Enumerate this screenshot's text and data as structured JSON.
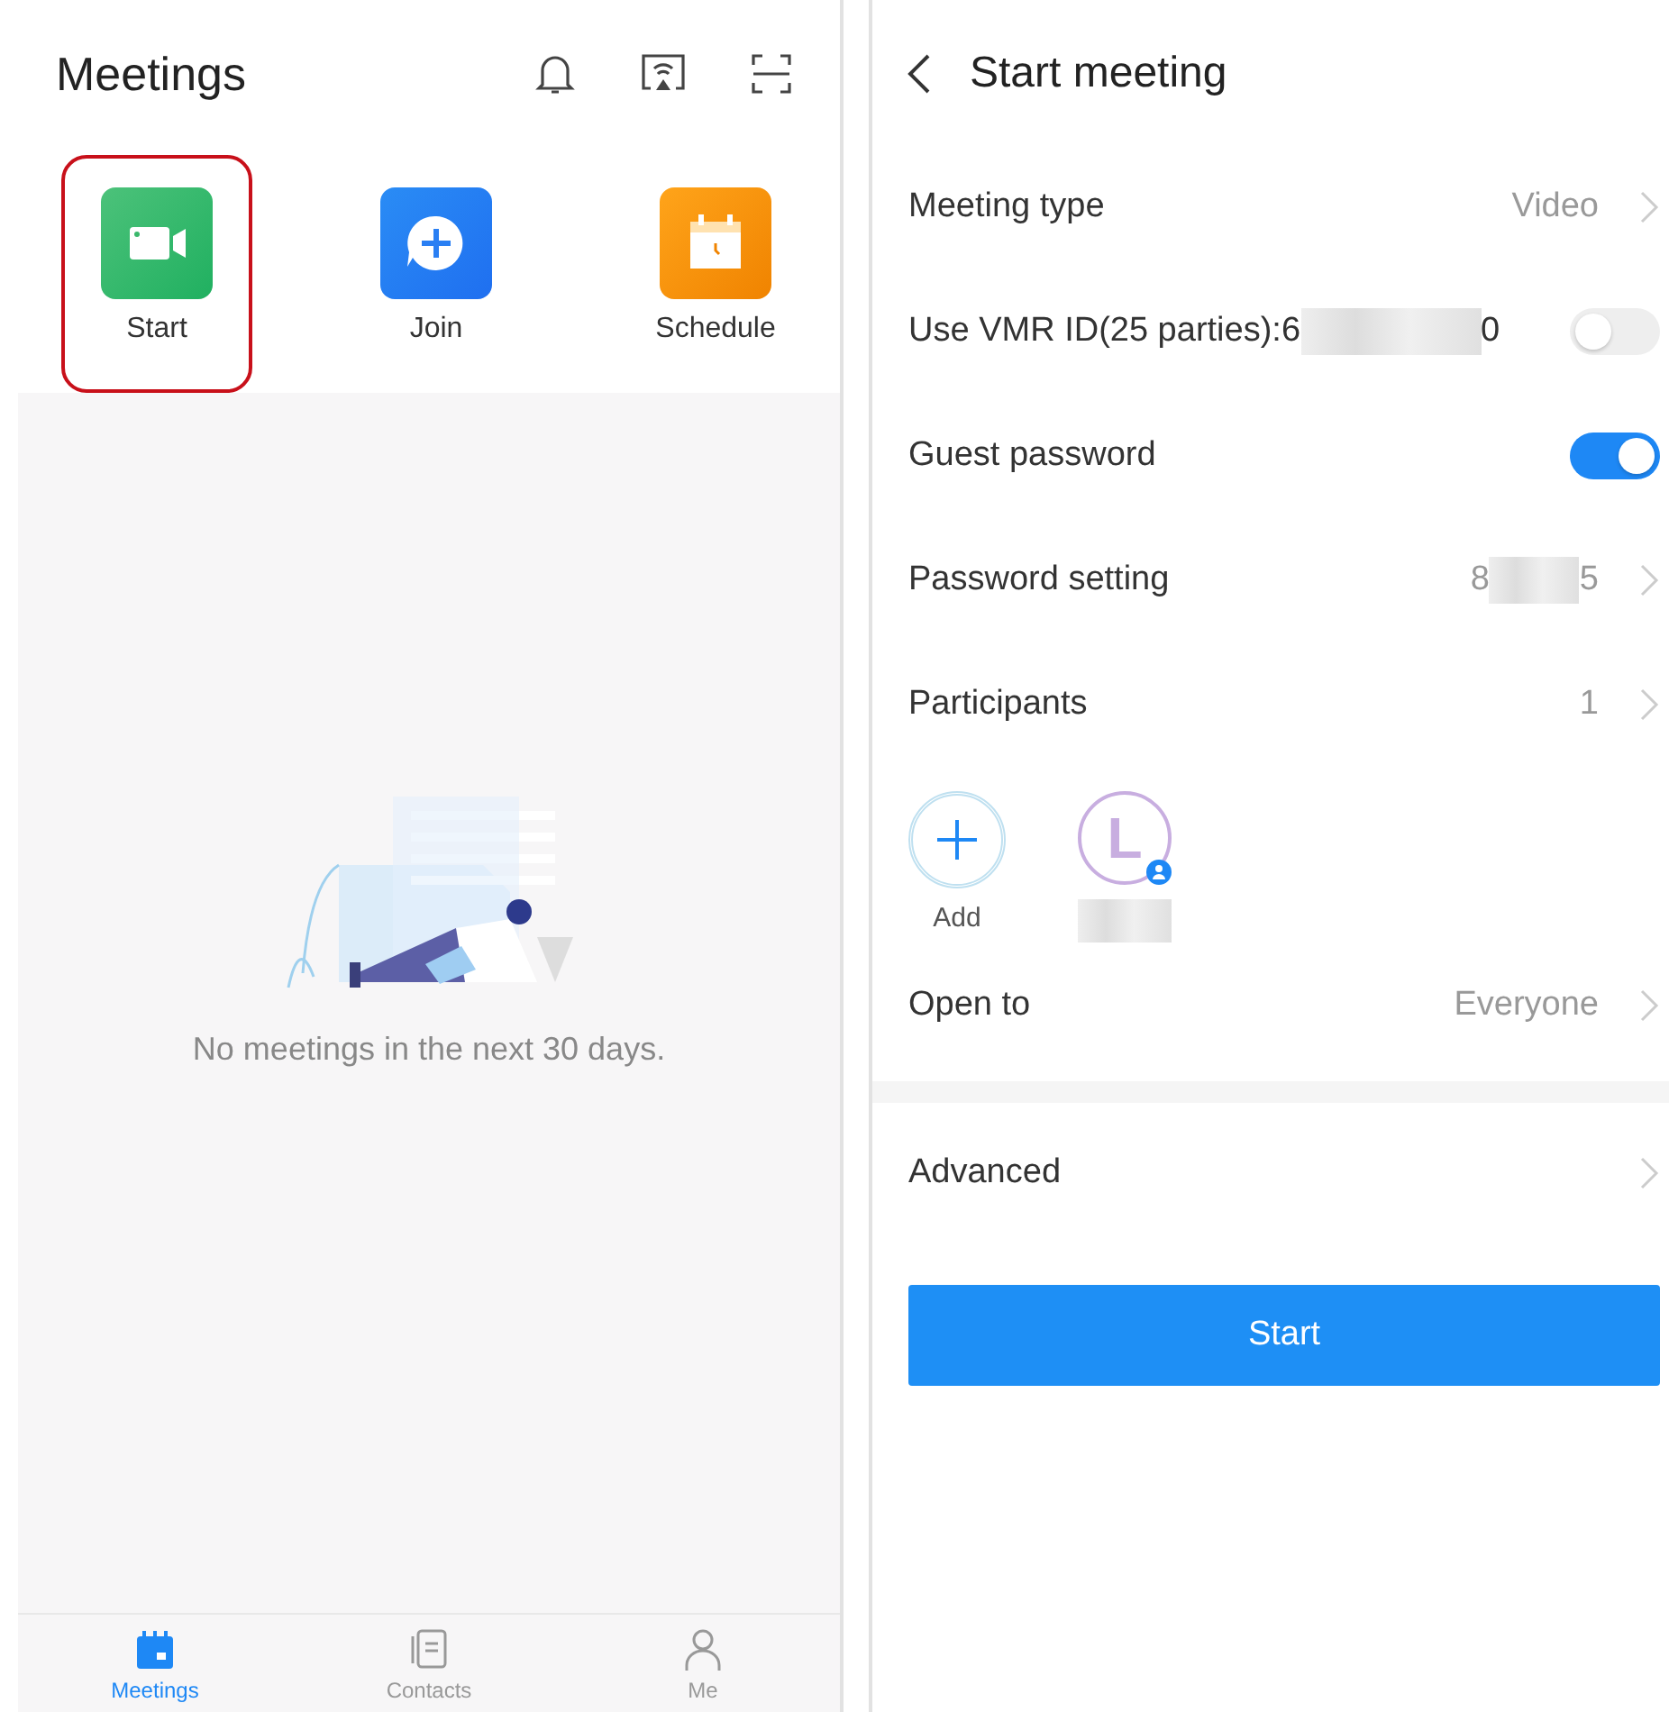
{
  "meetings_screen": {
    "title": "Meetings",
    "actions": [
      {
        "kind": "video",
        "label": "Start",
        "highlighted": true
      },
      {
        "kind": "join",
        "label": "Join",
        "highlighted": false
      },
      {
        "kind": "schedule",
        "label": "Schedule",
        "highlighted": false
      }
    ],
    "empty_message": "No meetings in the next 30 days.",
    "nav": [
      {
        "kind": "calendar",
        "label": "Meetings",
        "selected": true
      },
      {
        "kind": "contacts",
        "label": "Contacts",
        "selected": false
      },
      {
        "kind": "person",
        "label": "Me",
        "selected": false
      }
    ]
  },
  "start_screen": {
    "title": "Start meeting",
    "rows": [
      {
        "kind": "link",
        "label": "Meeting type",
        "value": "Video"
      },
      {
        "kind": "toggle",
        "label": "Use VMR ID(25 parties):6",
        "value_end": "0",
        "on": false
      },
      {
        "kind": "toggle",
        "label": "Guest password",
        "on": true
      },
      {
        "kind": "link",
        "label": "Password setting",
        "value": "8",
        "value_end": "5"
      },
      {
        "kind": "link",
        "label": "Participants",
        "value": "1"
      },
      {
        "kind": "people",
        "add_label": "Add",
        "avatar_letter": "L"
      },
      {
        "kind": "link",
        "label": "Open to",
        "value": "Everyone"
      },
      {
        "kind": "divider"
      },
      {
        "kind": "link",
        "label": "Advanced"
      }
    ],
    "start_button": "Start"
  }
}
